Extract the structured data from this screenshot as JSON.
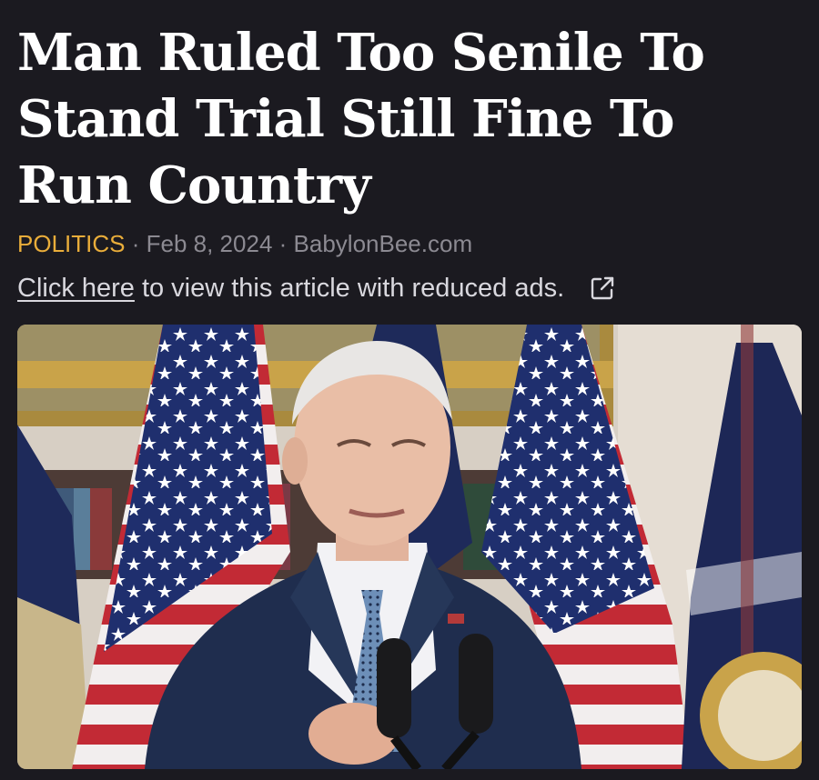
{
  "article": {
    "headline_lines": [
      "Man Ruled Too Senile To",
      "Stand Trial Still Fine To",
      "Run Country"
    ],
    "category": "POLITICS",
    "separator": "·",
    "date": "Feb 8, 2024",
    "source": "BabylonBee.com"
  },
  "promo": {
    "link_text": "Click here",
    "rest_text": "to view this article with reduced ads.",
    "icon": "external-link-icon"
  },
  "image": {
    "subject": "photo-of-speaker-at-podium"
  },
  "colors": {
    "background": "#1b1a20",
    "category": "#e9ad3a",
    "meta": "#8c8a92",
    "text": "#ffffff"
  }
}
